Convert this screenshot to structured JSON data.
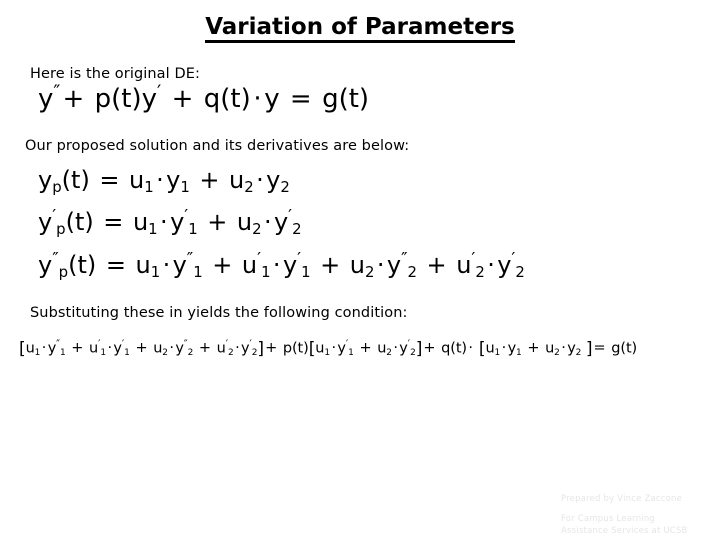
{
  "slide": {
    "title": "Variation of Parameters",
    "background_color": "#ffffff",
    "text_color": "#000000"
  },
  "body": {
    "line_1": "Here is the original DE:",
    "line_2": "Our proposed solution and its derivatives are below:",
    "line_3": "Substituting these in yields the following condition:"
  },
  "equations": {
    "original_de": {
      "plain": "y″ + p(t)y′ + q(t) · y = g(t)",
      "parts": {
        "y": "y",
        "double_prime": "″",
        "plus": "+",
        "p_of_t": "p(t)",
        "prime": "′",
        "q_of_t": "q(t)",
        "dot": "·",
        "equals": "=",
        "g_of_t": "g(t)"
      }
    },
    "proposed_solution": {
      "plain": "yₚ(t) = u₁ · y₁ + u₂ · y₂"
    },
    "first_derivative": {
      "plain": "y′ₚ(t) = u₁ · y′₁ + u₂ · y′₂"
    },
    "second_derivative": {
      "plain": "y″ₚ(t) = u₁ · y″₁ + u′₁ · y′₁ + u₂ · y″₂ + u′₂ · y′₂"
    },
    "substituted_condition": {
      "plain": "[u₁ · y″₁ + u′₁ · y′₁ + u₂ · y″₂ + u′₂ · y′₂] + p(t)[u₁ · y′₁ + u₂ · y′₂] + q(t) · [u₁ · y₁ + u₂ · y₂] = g(t)"
    },
    "symbols": {
      "u": "u",
      "y": "y",
      "p": "p",
      "t": "t",
      "one": "1",
      "two": "2",
      "prime": "′",
      "double_prime": "″",
      "plus": "+",
      "dot": "·",
      "equals": "=",
      "open_paren": "(",
      "close_paren": ")",
      "open_bracket": "[",
      "close_bracket": "]",
      "p_of_t": "p(t)",
      "q_of_t": "q(t)",
      "g_of_t": "g(t)"
    }
  },
  "credit": {
    "line_1": "Prepared by Vince Zaccone",
    "line_2": "For Campus Learning",
    "line_3": "Assistance Services at UCSB",
    "color": "#e6e6e6"
  }
}
